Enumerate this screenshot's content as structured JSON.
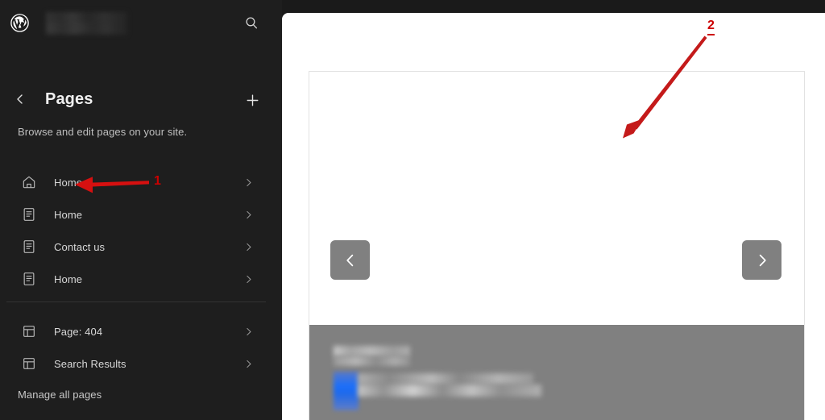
{
  "app": {
    "name": "WordPress Site Editor",
    "logo_icon": "wordpress-logo-icon",
    "site_title": "",
    "site_title_state": "blurred-redacted"
  },
  "sidebar": {
    "search_icon": "search-icon",
    "back_icon": "chevron-left-icon",
    "add_icon": "plus-icon",
    "title": "Pages",
    "description": "Browse and edit pages on your site.",
    "pages": [
      {
        "label": "Home",
        "icon": "home-icon",
        "chevron": "chevron-right-icon"
      },
      {
        "label": "Home",
        "icon": "page-icon",
        "chevron": "chevron-right-icon"
      },
      {
        "label": "Contact us",
        "icon": "page-icon",
        "chevron": "chevron-right-icon"
      },
      {
        "label": "Home",
        "icon": "page-icon",
        "chevron": "chevron-right-icon"
      }
    ],
    "templates": [
      {
        "label": "Page: 404",
        "icon": "template-layout-icon",
        "chevron": "chevron-right-icon"
      },
      {
        "label": "Search Results",
        "icon": "template-layout-icon",
        "chevron": "chevron-right-icon"
      }
    ],
    "manage_link": "Manage all pages"
  },
  "preview": {
    "carousel_prev_icon": "chevron-left-icon",
    "carousel_next_icon": "chevron-right-icon",
    "footer_state": "blurred-redacted"
  },
  "annotations": [
    {
      "id": "1",
      "label": "1",
      "type": "arrow-left",
      "target": "sidebar-item-home-1"
    },
    {
      "id": "2",
      "label": "2",
      "type": "arrow-diagonal-down-left",
      "target": "preview-content-frame"
    }
  ],
  "colors": {
    "sidebar_bg": "#1e1e1e",
    "app_bg": "#1a1a1a",
    "preview_bg": "#ffffff",
    "annotation_red": "#cc0000",
    "carousel_gray": "#808080",
    "footer_gray": "#808080",
    "accent_blue": "#1a6efa"
  }
}
